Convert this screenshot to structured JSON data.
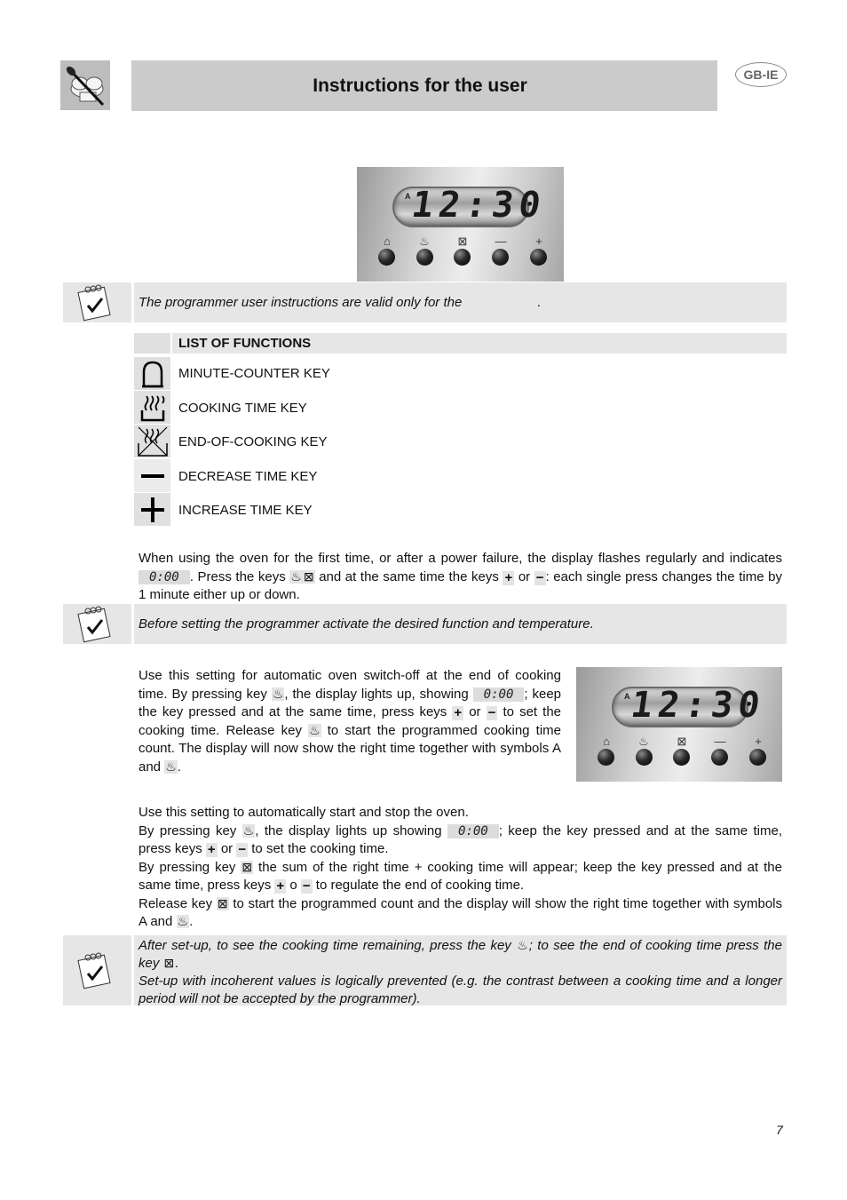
{
  "header": {
    "title": "Instructions for the user",
    "lang_badge": "GB-IE",
    "logo_icon": "chef-hat-spoon-icon"
  },
  "control_panel": {
    "display_time": "12:30",
    "auto_symbol": "A",
    "buttons": [
      {
        "name": "minute-counter",
        "symbol": "bell"
      },
      {
        "name": "cooking-time",
        "symbol": "pot"
      },
      {
        "name": "end-of-cooking",
        "symbol": "pot-crossed"
      },
      {
        "name": "decrease",
        "symbol": "−"
      },
      {
        "name": "increase",
        "symbol": "+"
      }
    ]
  },
  "notes": {
    "note1": "The programmer user instructions are valid only for the",
    "note1_end": ".",
    "note2": "Before setting the programmer activate the desired function and temperature.",
    "note3_a": "After set-up, to see the cooking time remaining, press the key",
    "note3_b": "; to see the end of cooking time press the key",
    "note3_c": ".",
    "note3_d": "Set-up with incoherent values is logically prevented (e.g. the contrast between a cooking time and a longer period will not be accepted by the programmer)."
  },
  "functions": {
    "heading": "LIST OF FUNCTIONS",
    "items": [
      {
        "icon": "bell-icon",
        "label": "MINUTE-COUNTER KEY"
      },
      {
        "icon": "cooking-time-icon",
        "label": "COOKING TIME KEY"
      },
      {
        "icon": "end-of-cooking-icon",
        "label": "END-OF-COOKING KEY"
      },
      {
        "icon": "minus-icon",
        "label": "DECREASE TIME KEY"
      },
      {
        "icon": "plus-icon",
        "label": "INCREASE TIME KEY"
      }
    ]
  },
  "lcd_zero": "0:00",
  "clock_setting": {
    "p1": "When using the oven for the first time, or after a power failure, the display flashes regularly and indicates",
    "p2": ". Press the keys",
    "p3": "and at the same time the keys",
    "p4": "or",
    "p5": ": each single press changes the time by 1 minute either up or down."
  },
  "semi_auto": {
    "p1": "Use this setting for automatic oven switch-off at the end of cooking time. By pressing key",
    "p2": ", the display lights up, showing",
    "p3": "; keep the key pressed and at the same time, press keys",
    "p4": "or",
    "p5": "to set the cooking time. Release key",
    "p6": "to start the programmed cooking time count. The display will now show the right time together with symbols A and",
    "p7": "."
  },
  "auto": {
    "l1": "Use this setting to automatically start and stop the oven.",
    "l2a": "By pressing key",
    "l2b": ", the display lights up showing",
    "l2c": "; keep the key pressed and at the same time, press keys",
    "l2d": "or",
    "l2e": "to set the cooking time.",
    "l3a": "By pressing key",
    "l3b": "the sum of the right time + cooking time will appear; keep the key pressed and at the same time, press keys",
    "l3c": "o",
    "l3d": "to regulate the end of cooking time.",
    "l4a": "Release key",
    "l4b": "to start the programmed count and the display will show the right time together with symbols A and",
    "l4c": "."
  },
  "page_number": "7"
}
